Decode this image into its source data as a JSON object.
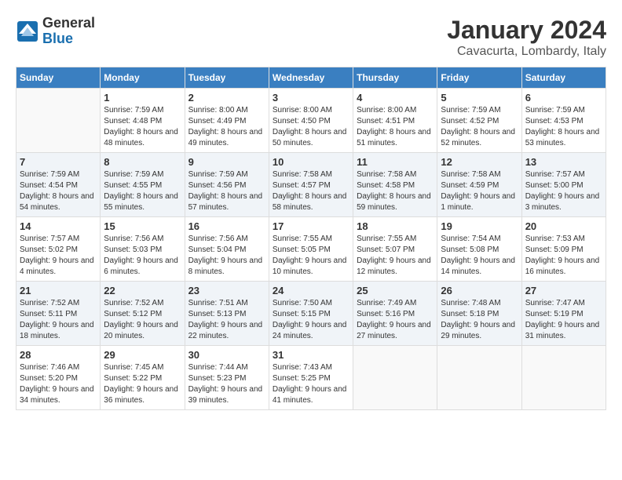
{
  "header": {
    "logo": {
      "general": "General",
      "blue": "Blue"
    },
    "title": "January 2024",
    "location": "Cavacurta, Lombardy, Italy"
  },
  "weekdays": [
    "Sunday",
    "Monday",
    "Tuesday",
    "Wednesday",
    "Thursday",
    "Friday",
    "Saturday"
  ],
  "weeks": [
    [
      {
        "day": "",
        "empty": true
      },
      {
        "day": "1",
        "sunrise": "7:59 AM",
        "sunset": "4:48 PM",
        "daylight": "8 hours and 48 minutes."
      },
      {
        "day": "2",
        "sunrise": "8:00 AM",
        "sunset": "4:49 PM",
        "daylight": "8 hours and 49 minutes."
      },
      {
        "day": "3",
        "sunrise": "8:00 AM",
        "sunset": "4:50 PM",
        "daylight": "8 hours and 50 minutes."
      },
      {
        "day": "4",
        "sunrise": "8:00 AM",
        "sunset": "4:51 PM",
        "daylight": "8 hours and 51 minutes."
      },
      {
        "day": "5",
        "sunrise": "7:59 AM",
        "sunset": "4:52 PM",
        "daylight": "8 hours and 52 minutes."
      },
      {
        "day": "6",
        "sunrise": "7:59 AM",
        "sunset": "4:53 PM",
        "daylight": "8 hours and 53 minutes."
      }
    ],
    [
      {
        "day": "7",
        "sunrise": "7:59 AM",
        "sunset": "4:54 PM",
        "daylight": "8 hours and 54 minutes."
      },
      {
        "day": "8",
        "sunrise": "7:59 AM",
        "sunset": "4:55 PM",
        "daylight": "8 hours and 55 minutes."
      },
      {
        "day": "9",
        "sunrise": "7:59 AM",
        "sunset": "4:56 PM",
        "daylight": "8 hours and 57 minutes."
      },
      {
        "day": "10",
        "sunrise": "7:58 AM",
        "sunset": "4:57 PM",
        "daylight": "8 hours and 58 minutes."
      },
      {
        "day": "11",
        "sunrise": "7:58 AM",
        "sunset": "4:58 PM",
        "daylight": "8 hours and 59 minutes."
      },
      {
        "day": "12",
        "sunrise": "7:58 AM",
        "sunset": "4:59 PM",
        "daylight": "9 hours and 1 minute."
      },
      {
        "day": "13",
        "sunrise": "7:57 AM",
        "sunset": "5:00 PM",
        "daylight": "9 hours and 3 minutes."
      }
    ],
    [
      {
        "day": "14",
        "sunrise": "7:57 AM",
        "sunset": "5:02 PM",
        "daylight": "9 hours and 4 minutes."
      },
      {
        "day": "15",
        "sunrise": "7:56 AM",
        "sunset": "5:03 PM",
        "daylight": "9 hours and 6 minutes."
      },
      {
        "day": "16",
        "sunrise": "7:56 AM",
        "sunset": "5:04 PM",
        "daylight": "9 hours and 8 minutes."
      },
      {
        "day": "17",
        "sunrise": "7:55 AM",
        "sunset": "5:05 PM",
        "daylight": "9 hours and 10 minutes."
      },
      {
        "day": "18",
        "sunrise": "7:55 AM",
        "sunset": "5:07 PM",
        "daylight": "9 hours and 12 minutes."
      },
      {
        "day": "19",
        "sunrise": "7:54 AM",
        "sunset": "5:08 PM",
        "daylight": "9 hours and 14 minutes."
      },
      {
        "day": "20",
        "sunrise": "7:53 AM",
        "sunset": "5:09 PM",
        "daylight": "9 hours and 16 minutes."
      }
    ],
    [
      {
        "day": "21",
        "sunrise": "7:52 AM",
        "sunset": "5:11 PM",
        "daylight": "9 hours and 18 minutes."
      },
      {
        "day": "22",
        "sunrise": "7:52 AM",
        "sunset": "5:12 PM",
        "daylight": "9 hours and 20 minutes."
      },
      {
        "day": "23",
        "sunrise": "7:51 AM",
        "sunset": "5:13 PM",
        "daylight": "9 hours and 22 minutes."
      },
      {
        "day": "24",
        "sunrise": "7:50 AM",
        "sunset": "5:15 PM",
        "daylight": "9 hours and 24 minutes."
      },
      {
        "day": "25",
        "sunrise": "7:49 AM",
        "sunset": "5:16 PM",
        "daylight": "9 hours and 27 minutes."
      },
      {
        "day": "26",
        "sunrise": "7:48 AM",
        "sunset": "5:18 PM",
        "daylight": "9 hours and 29 minutes."
      },
      {
        "day": "27",
        "sunrise": "7:47 AM",
        "sunset": "5:19 PM",
        "daylight": "9 hours and 31 minutes."
      }
    ],
    [
      {
        "day": "28",
        "sunrise": "7:46 AM",
        "sunset": "5:20 PM",
        "daylight": "9 hours and 34 minutes."
      },
      {
        "day": "29",
        "sunrise": "7:45 AM",
        "sunset": "5:22 PM",
        "daylight": "9 hours and 36 minutes."
      },
      {
        "day": "30",
        "sunrise": "7:44 AM",
        "sunset": "5:23 PM",
        "daylight": "9 hours and 39 minutes."
      },
      {
        "day": "31",
        "sunrise": "7:43 AM",
        "sunset": "5:25 PM",
        "daylight": "9 hours and 41 minutes."
      },
      {
        "day": "",
        "empty": true
      },
      {
        "day": "",
        "empty": true
      },
      {
        "day": "",
        "empty": true
      }
    ]
  ],
  "labels": {
    "sunrise": "Sunrise:",
    "sunset": "Sunset:",
    "daylight": "Daylight:"
  }
}
